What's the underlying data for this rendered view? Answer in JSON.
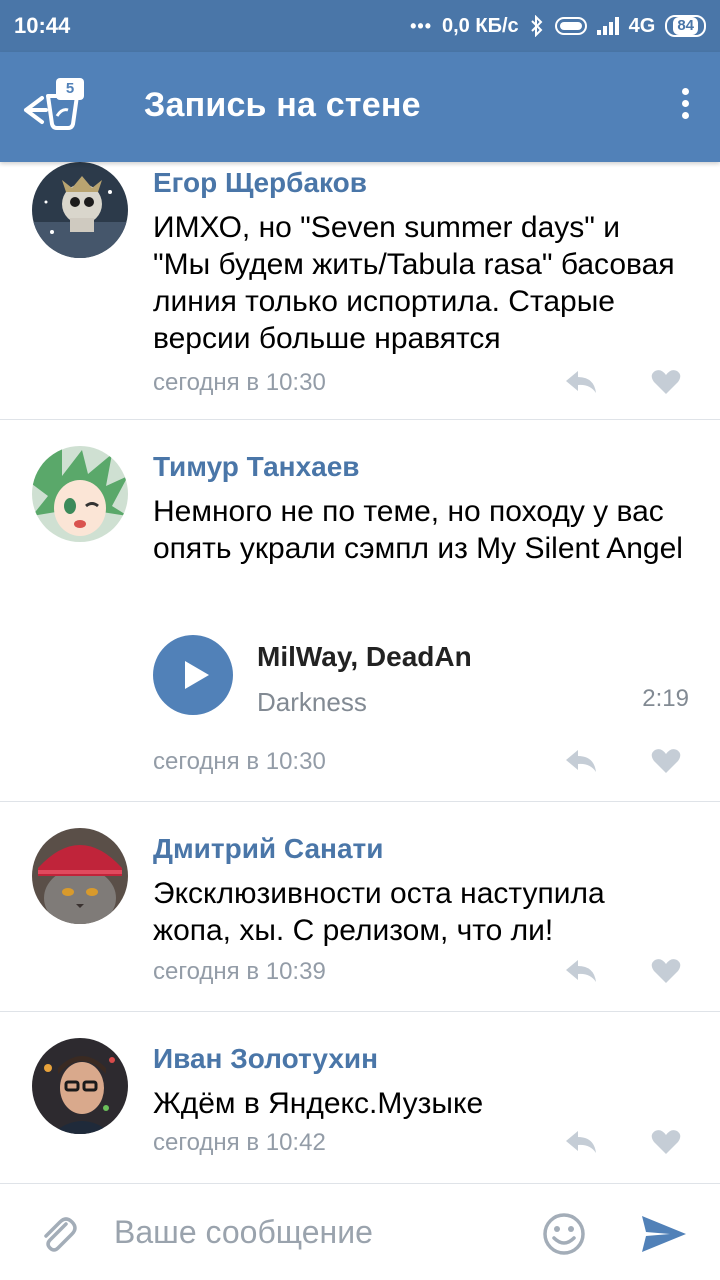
{
  "status_bar": {
    "time": "10:44",
    "dots": "•••",
    "speed": "0,0 КБ/с",
    "network": "4G",
    "battery": "84"
  },
  "header": {
    "title": "Запись на стене",
    "back_badge": "5"
  },
  "comments": [
    {
      "author": "Егор Щербаков",
      "text": "ИМХО, но \"Seven summer days\" и \"Мы будем жить/Tabula rasa\" басовая линия только испортила. Старые версии больше нравятся",
      "time": "сегодня в 10:30"
    },
    {
      "author": "Тимур Танхаев",
      "text": "Немного не по теме, но походу у вас опять украли сэмпл из My Silent Angel",
      "time": "сегодня в 10:30",
      "audio": {
        "artist": "MilWay, DeadAn",
        "title": "Darkness",
        "duration": "2:19"
      }
    },
    {
      "author": "Дмитрий Санати",
      "text": "Эксклюзивности оста наступила жопа, хы. С релизом, что ли!",
      "time": "сегодня в 10:39"
    },
    {
      "author": "Иван Золотухин",
      "text": "Ждём в Яндекс.Музыке",
      "time": "сегодня в 10:42"
    }
  ],
  "composer": {
    "placeholder": "Ваше сообщение"
  },
  "colors": {
    "brand": "#5181b8",
    "status_bar": "#4a76a8",
    "author": "#4a76a8",
    "meta": "#939ca7"
  },
  "icons": [
    "back-arrow-icon",
    "more-vertical-icon",
    "reply-icon",
    "heart-icon",
    "play-icon",
    "paperclip-icon",
    "smiley-icon",
    "send-icon",
    "bluetooth-icon",
    "signal-icon",
    "battery-icon"
  ]
}
